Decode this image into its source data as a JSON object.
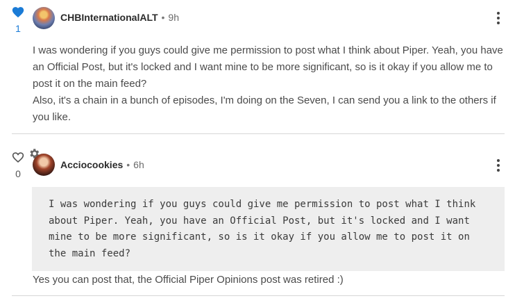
{
  "comments": [
    {
      "likes": "1",
      "liked": true,
      "username": "CHBInternationalALT",
      "separator": "•",
      "time": "9h",
      "paragraphs": [
        "I was wondering if you guys could give me permission to post what I think about Piper. Yeah, you have an Official Post, but it's locked and I want mine to be more significant, so is it okay if you allow me to post it on the main feed?",
        "Also, it's a chain in a bunch of episodes, I'm doing on the Seven, I can send you a link to the others if you like."
      ]
    },
    {
      "likes": "0",
      "liked": false,
      "username": "Acciocookies",
      "separator": "•",
      "time": "6h",
      "quote": "I was wondering if you guys could give me permission to post what I think about Piper. Yeah, you have an Official Post, but it's locked and I want mine to be more significant, so is it okay if you allow me to post it on the main feed?",
      "reply": "Yes you can post that, the Official Piper Opinions post was retired :)"
    }
  ],
  "colors": {
    "liked_heart": "#1a7bd6",
    "divider": "#d6d6d6",
    "quote_bg": "#eeeeee"
  }
}
